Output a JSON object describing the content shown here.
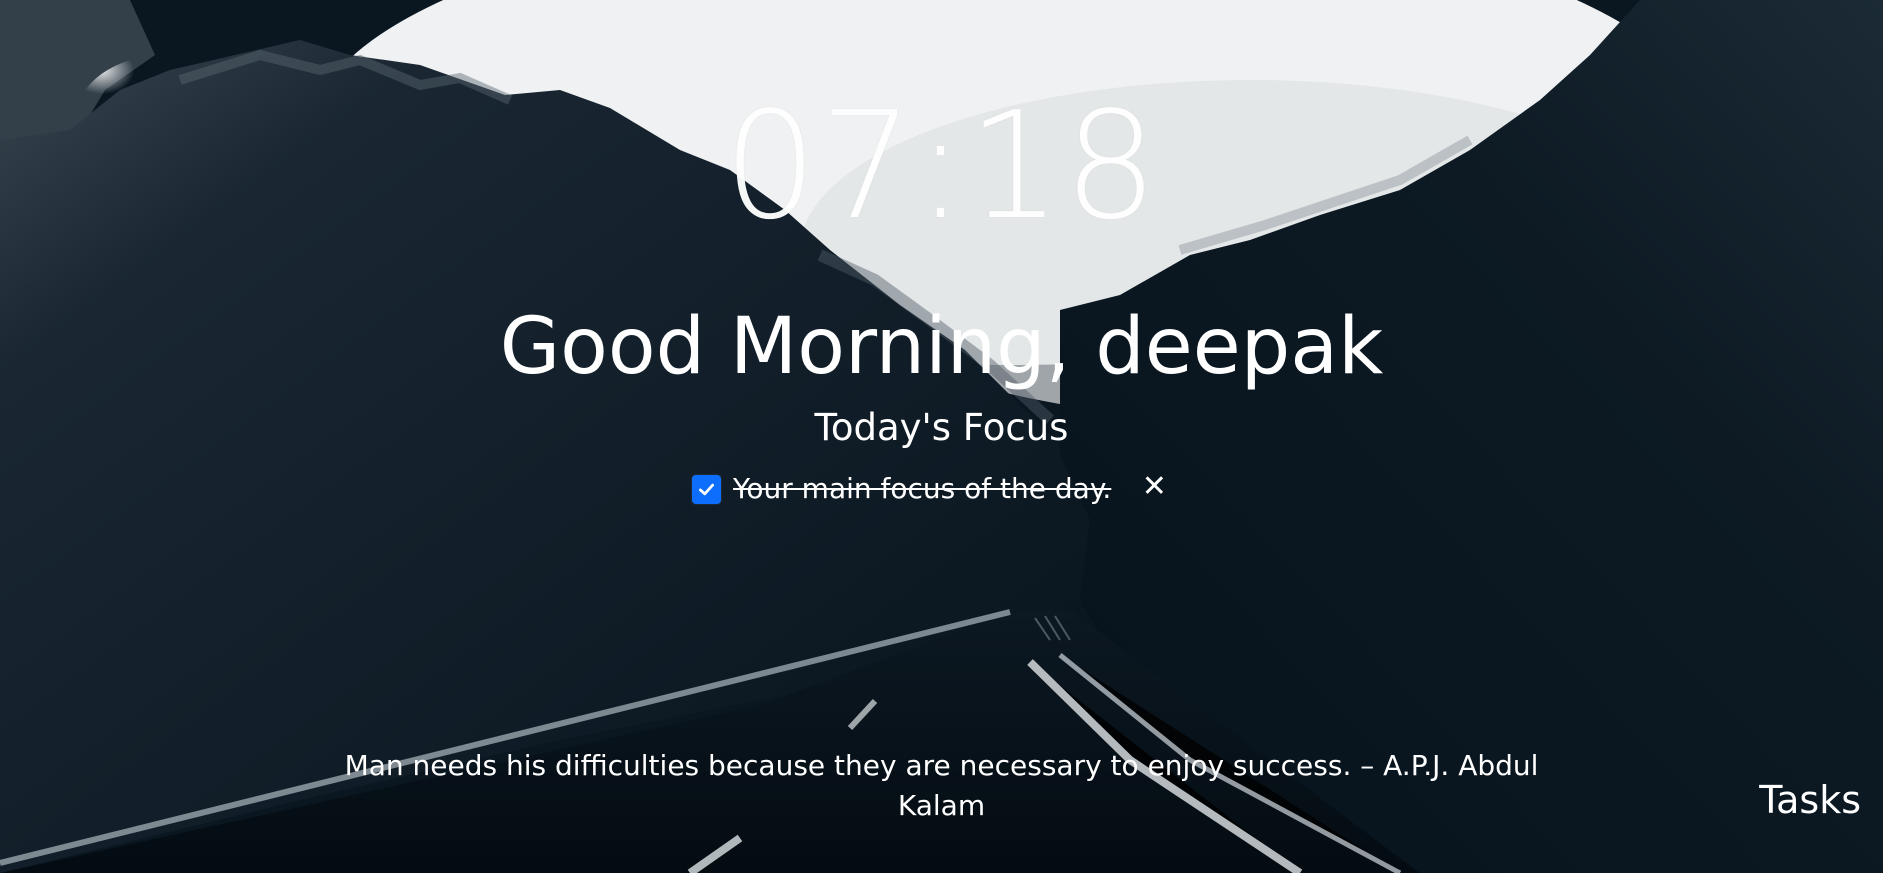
{
  "theme": {
    "text_color": "#ffffff",
    "checkbox_color": "#0d6efd",
    "sky_color": "#eceeef",
    "mountain_color": "#101d27",
    "road_color": "#07131c"
  },
  "clock": {
    "time": "07:18"
  },
  "greeting": {
    "text": "Good Morning, deepak"
  },
  "focus": {
    "title": "Today's Focus",
    "item_text": "Your main focus of the day.",
    "checked": true,
    "checkbox_icon": "check-icon",
    "close_icon": "close-icon",
    "close_label": "✕"
  },
  "quote": {
    "text": "Man needs his difficulties because they are necessary to enjoy success. – A.P.J. Abdul Kalam"
  },
  "tasks": {
    "label": "Tasks"
  }
}
